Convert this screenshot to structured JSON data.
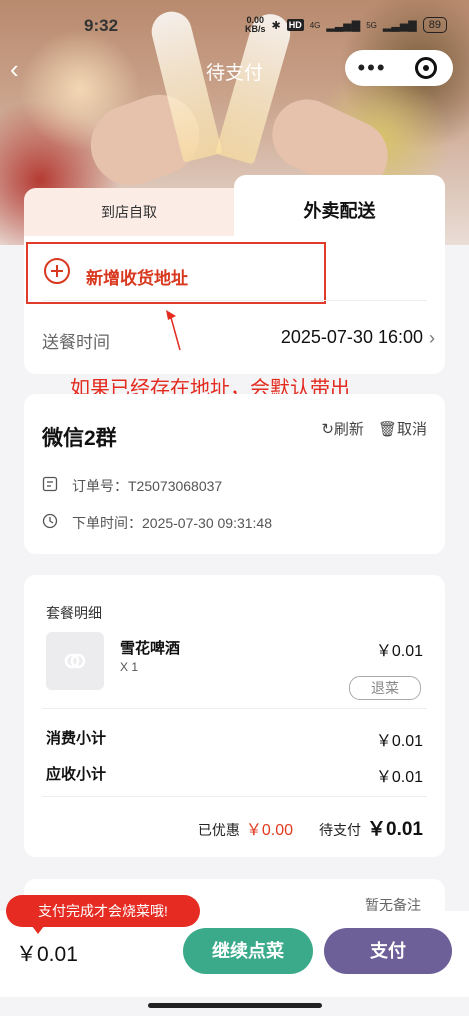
{
  "status_bar": {
    "time": "9:32",
    "speed": "0.00",
    "speed_unit": "KB/s",
    "hd": "HD",
    "net1": "4G",
    "net2": "5G",
    "battery": "89"
  },
  "nav": {
    "title": "待支付",
    "more": "•••"
  },
  "tabs": [
    {
      "label": "到店自取"
    },
    {
      "label": "外卖配送"
    }
  ],
  "address": {
    "add_label": "新增收货地址"
  },
  "delivery_time": {
    "label": "送餐时间",
    "value": "2025-07-30 16:00"
  },
  "annotation": "如果已经存在地址，会默认带出",
  "order": {
    "group_name": "微信2群",
    "refresh": "刷新",
    "cancel": "取消",
    "order_no_label": "订单号：",
    "order_no": "T25073068037",
    "order_time_label": "下单时间：",
    "order_time": "2025-07-30 09:31:48"
  },
  "detail": {
    "title": "套餐明细",
    "items": [
      {
        "name": "雪花啤酒",
        "qty": "X 1",
        "price": "￥0.01",
        "refund": "退菜"
      }
    ],
    "subtotal_label": "消费小计",
    "subtotal": "￥0.01",
    "receivable_label": "应收小计",
    "receivable": "￥0.01",
    "discount_label": "已优惠",
    "discount": "￥0.00",
    "to_pay_label": "待支付",
    "to_pay": "￥0.01"
  },
  "remark": "暂无备注",
  "bottom": {
    "tooltip": "支付完成才会烧菜哦!",
    "total": "￥0.01",
    "continue_label": "继续点菜",
    "pay_label": "支付"
  },
  "colors": {
    "accent_red": "#e33a1f",
    "continue_green": "#3aaa8a",
    "pay_purple": "#6d5f97"
  }
}
